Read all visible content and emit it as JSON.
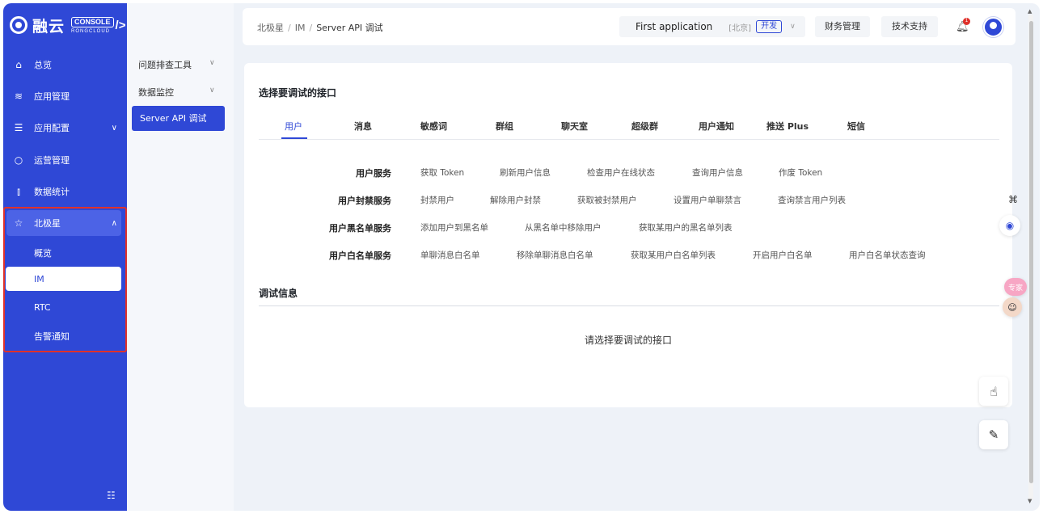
{
  "brand": {
    "name": "融云",
    "badge_top": "CONSOLE",
    "badge_bottom": "RONGCLOUD",
    "arrow": "/>"
  },
  "sidebar": {
    "items": [
      {
        "label": "总览",
        "icon": "home-icon"
      },
      {
        "label": "应用管理",
        "icon": "layers-icon"
      },
      {
        "label": "应用配置",
        "icon": "sliders-icon",
        "chevron": "down"
      },
      {
        "label": "运营管理",
        "icon": "shield-icon"
      },
      {
        "label": "数据统计",
        "icon": "bar-chart-icon"
      },
      {
        "label": "北极星",
        "icon": "star-icon",
        "chevron": "up",
        "expanded": true
      }
    ],
    "polaris_children": [
      {
        "label": "概览"
      },
      {
        "label": "IM",
        "selected": true
      },
      {
        "label": "RTC"
      },
      {
        "label": "告警通知"
      }
    ]
  },
  "submenu": {
    "items": [
      {
        "label": "问题排查工具",
        "chevron": "down"
      },
      {
        "label": "数据监控",
        "chevron": "down"
      },
      {
        "label": "Server API 调试",
        "selected": true
      }
    ]
  },
  "header": {
    "breadcrumb": [
      "北极星",
      "IM",
      "Server API 调试"
    ],
    "app_name": "First application",
    "region": "[北京]",
    "env": "开发",
    "finance": "财务管理",
    "support": "技术支持",
    "notification_count": "1"
  },
  "main": {
    "select_title": "选择要调试的接口",
    "tabs": [
      "用户",
      "消息",
      "敏感词",
      "群组",
      "聊天室",
      "超级群",
      "用户通知",
      "推送 Plus",
      "短信"
    ],
    "active_tab": "用户",
    "groups": [
      {
        "label": "用户服务",
        "apis": [
          "获取 Token",
          "刷新用户信息",
          "检查用户在线状态",
          "查询用户信息",
          "作废 Token"
        ]
      },
      {
        "label": "用户封禁服务",
        "apis": [
          "封禁用户",
          "解除用户封禁",
          "获取被封禁用户",
          "设置用户单聊禁言",
          "查询禁言用户列表"
        ]
      },
      {
        "label": "用户黑名单服务",
        "apis": [
          "添加用户到黑名单",
          "从黑名单中移除用户",
          "获取某用户的黑名单列表"
        ]
      },
      {
        "label": "用户白名单服务",
        "apis": [
          "单聊消息白名单",
          "移除单聊消息白名单",
          "获取某用户白名单列表",
          "开启用户白名单",
          "用户白名单状态查询"
        ]
      }
    ],
    "debug_title": "调试信息",
    "empty_message": "请选择要调试的接口"
  },
  "floaters": {
    "chat_bubble": "专家"
  },
  "colors": {
    "primary": "#2f48d6",
    "highlight_border": "#e0312b"
  }
}
